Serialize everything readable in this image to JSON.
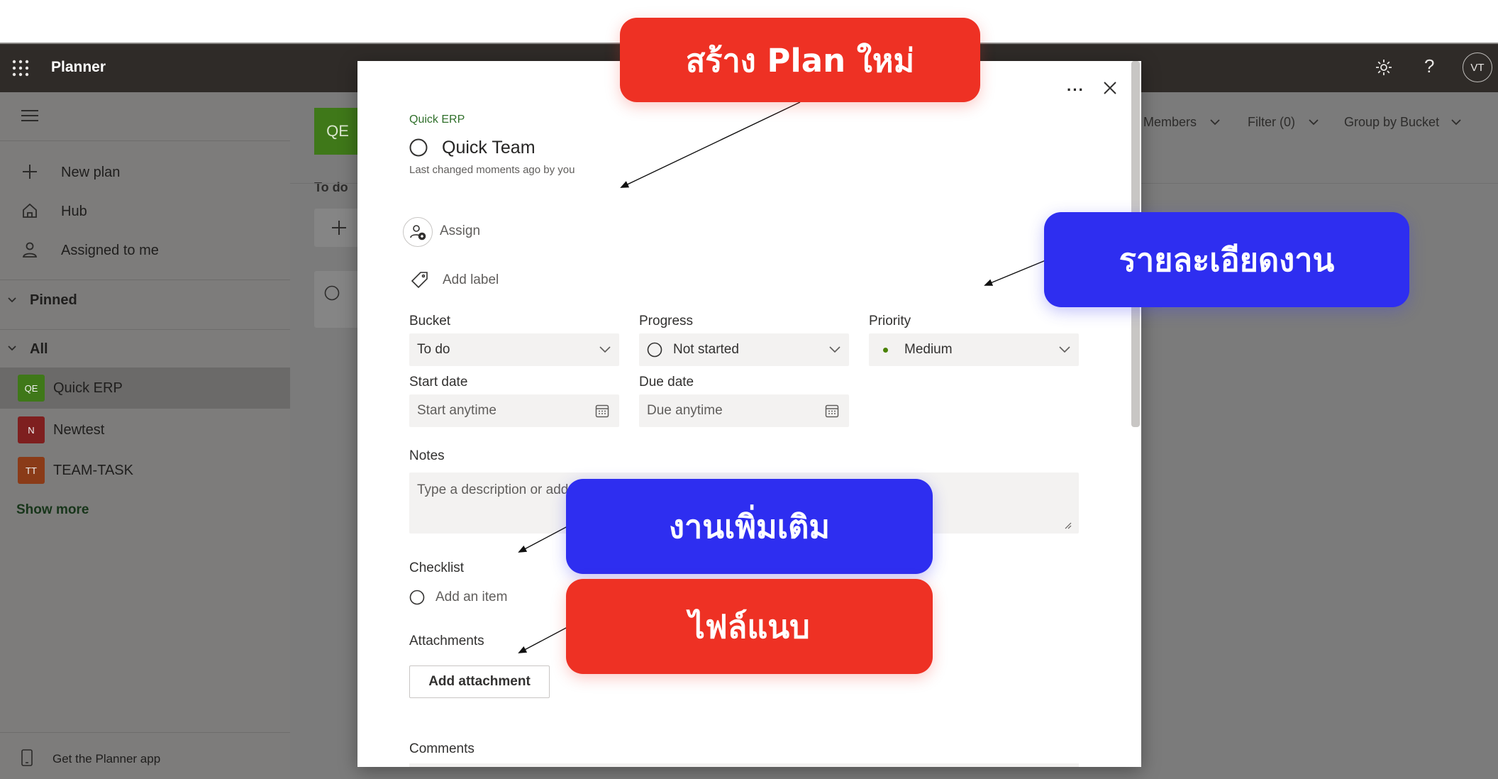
{
  "header": {
    "app_name": "Planner",
    "avatar_initials": "VT"
  },
  "nav": {
    "items": [
      {
        "label": "New plan",
        "icon": "plus-icon"
      },
      {
        "label": "Hub",
        "icon": "home-icon"
      },
      {
        "label": "Assigned to me",
        "icon": "person-icon"
      }
    ],
    "pinned_label": "Pinned",
    "all_label": "All",
    "plans": [
      {
        "badge": "QE",
        "name": "Quick ERP",
        "color": "#4b8a1f"
      },
      {
        "badge": "N",
        "name": "Newtest",
        "color": "#9b2525"
      },
      {
        "badge": "TT",
        "name": "TEAM-TASK",
        "color": "#a8481f"
      }
    ],
    "show_more": "Show more",
    "get_app": "Get the Planner app"
  },
  "board": {
    "plan_badge": "QE",
    "bucket_title": "To do",
    "toolbar": {
      "members": "Members",
      "filter": "Filter (0)",
      "group_by": "Group by Bucket"
    }
  },
  "task": {
    "plan_name": "Quick ERP",
    "title": "Quick Team",
    "last_changed": "Last changed moments ago by you",
    "assign": "Assign",
    "add_label": "Add label",
    "bucket": {
      "label": "Bucket",
      "value": "To do"
    },
    "progress": {
      "label": "Progress",
      "value": "Not started"
    },
    "priority": {
      "label": "Priority",
      "value": "Medium"
    },
    "start_date": {
      "label": "Start date",
      "placeholder": "Start anytime"
    },
    "due_date": {
      "label": "Due date",
      "placeholder": "Due anytime"
    },
    "notes": {
      "label": "Notes",
      "placeholder": "Type a description or add"
    },
    "checklist": {
      "label": "Checklist",
      "add_item": "Add an item"
    },
    "attachments": {
      "label": "Attachments",
      "button": "Add attachment"
    },
    "comments": {
      "label": "Comments"
    }
  },
  "callouts": {
    "create_plan": "สร้าง Plan ใหม่",
    "task_details": "รายละเอียดงาน",
    "more_work": "งานเพิ่มเติม",
    "attach_file": "ไฟล์แนบ"
  },
  "colors": {
    "red": "#ee3124",
    "blue": "#2e2ef0",
    "topbar": "#2f2b28"
  }
}
